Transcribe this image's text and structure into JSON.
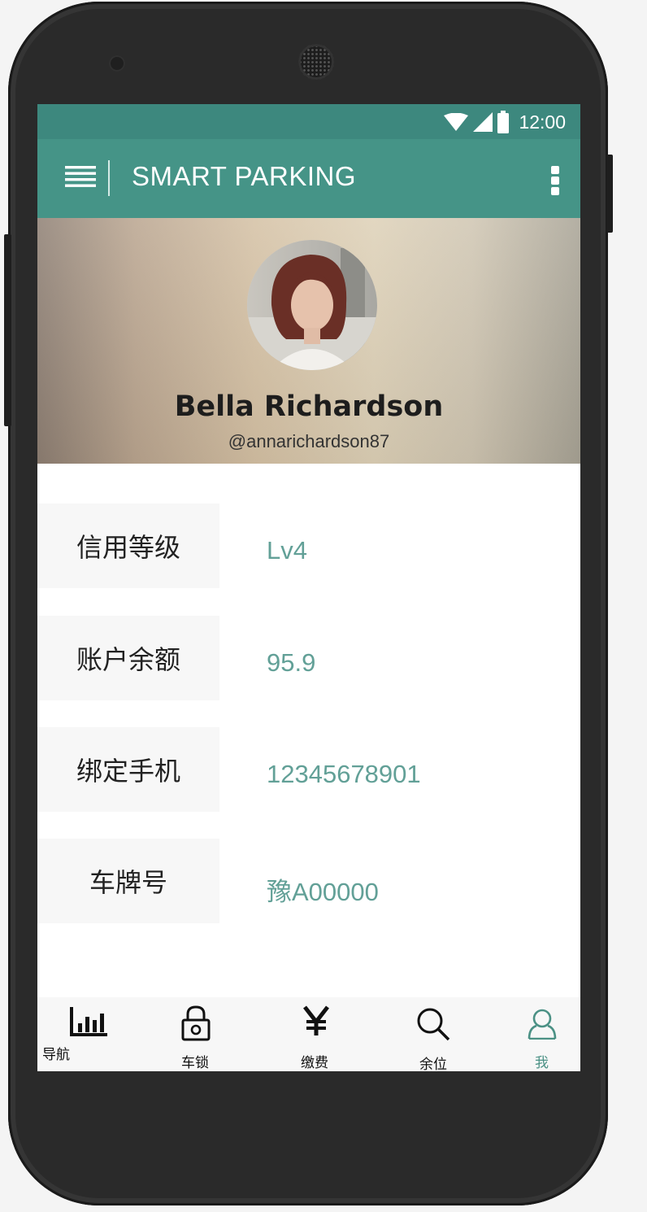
{
  "status_bar": {
    "time": "12:00",
    "icons": [
      "wifi-icon",
      "signal-icon",
      "battery-icon"
    ]
  },
  "app_bar": {
    "title": "SMART PARKING",
    "menu_icon": "hamburger-icon",
    "more_icon": "more-vert-icon"
  },
  "profile": {
    "name": "Bella Richardson",
    "handle": "@annarichardson87"
  },
  "info_rows": [
    {
      "label": "信用等级",
      "value": "Lv4"
    },
    {
      "label": "账户余额",
      "value": "95.9"
    },
    {
      "label": "绑定手机",
      "value": "12345678901"
    },
    {
      "label": "车牌号",
      "value": "豫A00000"
    }
  ],
  "bottom_nav": [
    {
      "label": "导航",
      "icon": "bar-chart-icon",
      "active": false
    },
    {
      "label": "车锁",
      "icon": "lock-icon",
      "active": false
    },
    {
      "label": "缴费",
      "icon": "yen-icon",
      "active": false
    },
    {
      "label": "余位",
      "icon": "search-icon",
      "active": false
    },
    {
      "label": "我",
      "icon": "person-icon",
      "active": true
    }
  ],
  "colors": {
    "status_bar": "#3d887e",
    "app_bar": "#459487",
    "value_text": "#62a097",
    "nav_active": "#4b9185",
    "label_bg": "#f7f7f7"
  }
}
